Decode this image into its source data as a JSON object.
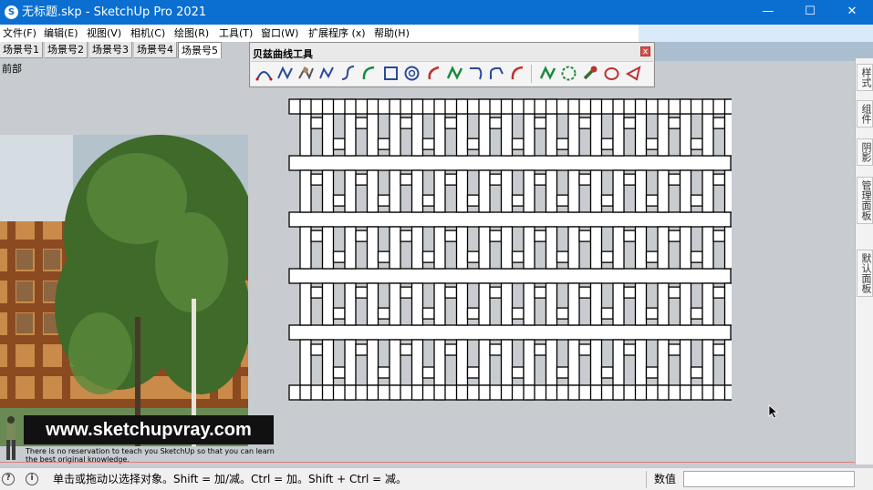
{
  "window": {
    "title": "无标题.skp - SketchUp Pro 2021",
    "app_icon_glyph": "S",
    "minimize_glyph": "—",
    "maximize_glyph": "☐",
    "close_glyph": "✕"
  },
  "menu": [
    "文件(F)",
    "编辑(E)",
    "视图(V)",
    "相机(C)",
    "绘图(R)",
    "工具(T)",
    "窗口(W)",
    "扩展程序 (x)",
    "帮助(H)"
  ],
  "scene_tabs": [
    "场景号1",
    "场景号2",
    "场景号3",
    "场景号4",
    "场景号5"
  ],
  "active_scene": "场景号5",
  "view_label": "前部",
  "bezier_toolbar": {
    "title": "贝兹曲线工具",
    "close_glyph": "x",
    "tools": [
      "bezier-icon",
      "spline-icon",
      "polyline-edit-icon",
      "freehand-icon",
      "cubic-icon",
      "arc-icon",
      "square-icon",
      "spiral-icon",
      "curve-icon",
      "s-curve-icon",
      "blend-icon",
      "corner-icon",
      "fillet-icon",
      "catmull-icon",
      "polygon-icon",
      "wrench-icon",
      "ellipse-icon",
      "triangle-icon"
    ]
  },
  "side_panel": [
    "样式",
    "组件",
    "阴影",
    "管理面板",
    "默认面板"
  ],
  "banner": {
    "url": "www.sketchupvray.com",
    "line1": "There is no reservation to teach you SketchUp so that you can learn",
    "line2": "the best original knowledge."
  },
  "status": {
    "message": "单击或拖动以选择对象。Shift = 加/减。Ctrl = 加。Shift + Ctrl = 减。",
    "measure_label": "数值",
    "measure_value": ""
  },
  "colors": {
    "titlebar": "#0a6fd1",
    "viewport": "#c8ccd0",
    "weave_fill": "#ffffff",
    "weave_stroke": "#000000"
  }
}
